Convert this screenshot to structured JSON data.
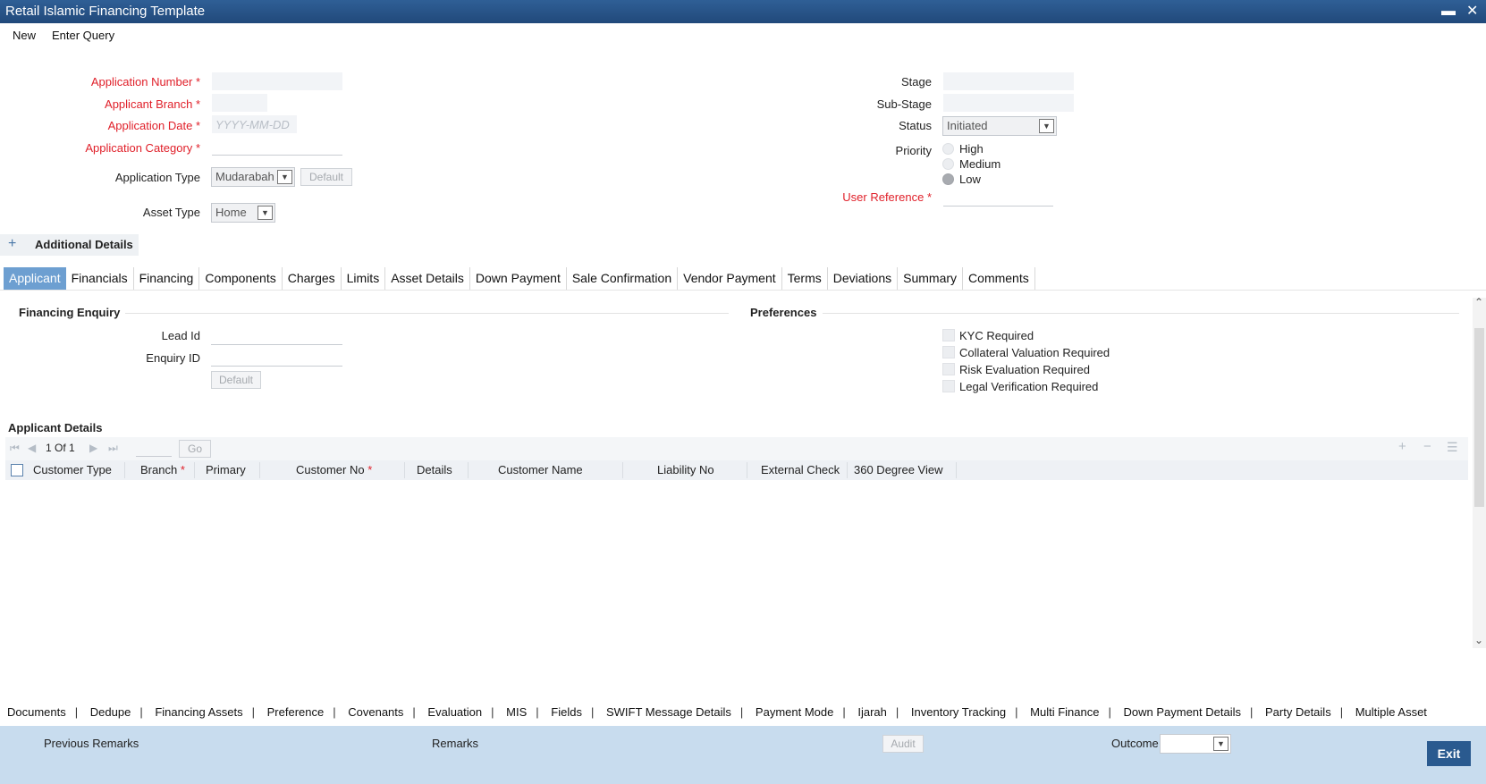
{
  "window": {
    "title": "Retail Islamic Financing Template",
    "minimize_glyph": "▬",
    "close_glyph": "✕"
  },
  "menu": {
    "new": "New",
    "enter_query": "Enter Query"
  },
  "header": {
    "application_number_label": "Application Number",
    "applicant_branch_label": "Applicant Branch",
    "application_date_label": "Application Date",
    "application_date_placeholder": "YYYY-MM-DD",
    "application_category_label": "Application Category",
    "application_type_label": "Application Type",
    "application_type_value": "Mudarabah",
    "default_label": "Default",
    "asset_type_label": "Asset Type",
    "asset_type_value": "Home",
    "required_marker": "*",
    "stage_label": "Stage",
    "sub_stage_label": "Sub-Stage",
    "status_label": "Status",
    "status_value": "Initiated",
    "priority_label": "Priority",
    "priority_options": [
      {
        "label": "High",
        "checked": false
      },
      {
        "label": "Medium",
        "checked": false
      },
      {
        "label": "Low",
        "checked": true
      }
    ],
    "user_reference_label": "User Reference"
  },
  "additional_details": {
    "plus": "+",
    "label": "Additional Details"
  },
  "tabs": [
    {
      "label": "Applicant",
      "active": true
    },
    {
      "label": "Financials"
    },
    {
      "label": "Financing"
    },
    {
      "label": "Components"
    },
    {
      "label": "Charges"
    },
    {
      "label": "Limits"
    },
    {
      "label": "Asset Details"
    },
    {
      "label": "Down Payment"
    },
    {
      "label": "Sale Confirmation"
    },
    {
      "label": "Vendor Payment"
    },
    {
      "label": "Terms"
    },
    {
      "label": "Deviations"
    },
    {
      "label": "Summary"
    },
    {
      "label": "Comments"
    }
  ],
  "financing_enquiry": {
    "title": "Financing Enquiry",
    "lead_id_label": "Lead Id",
    "enquiry_id_label": "Enquiry ID",
    "default_label": "Default"
  },
  "preferences": {
    "title": "Preferences",
    "items": [
      "KYC Required",
      "Collateral Valuation Required",
      "Risk Evaluation Required",
      "Legal Verification Required"
    ]
  },
  "applicant_details": {
    "title": "Applicant Details",
    "pager_text": "1 Of 1",
    "go_label": "Go",
    "columns": [
      "Customer Type",
      "Branch",
      "Primary",
      "Customer No",
      "Details",
      "Customer Name",
      "Liability No",
      "External Check",
      "360 Degree View"
    ]
  },
  "bottom_links": [
    "Documents",
    "Dedupe",
    "Financing Assets",
    "Preference",
    "Covenants",
    "Evaluation",
    "MIS",
    "Fields",
    "SWIFT Message Details",
    "Payment Mode",
    "Ijarah",
    "Inventory Tracking",
    "Multi Finance",
    "Down Payment Details",
    "Party Details",
    "Multiple Asset"
  ],
  "footer": {
    "previous_remarks_label": "Previous Remarks",
    "remarks_label": "Remarks",
    "audit_label": "Audit",
    "outcome_label": "Outcome",
    "exit_label": "Exit"
  },
  "colors": {
    "title_bar": "#21497a",
    "active_tab": "#6d9fd1",
    "required": "#e0202a",
    "footer": "#c8dcee",
    "exit_button": "#2a5a8f"
  }
}
